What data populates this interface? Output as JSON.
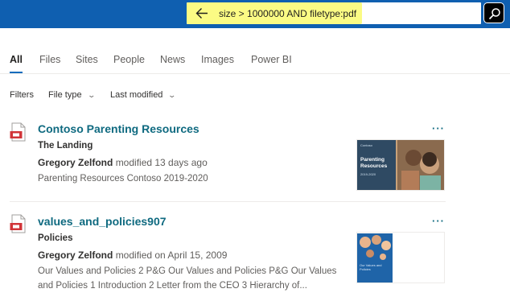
{
  "search": {
    "query": "size > 1000000 AND filetype:pdf"
  },
  "tabs": [
    {
      "label": "All"
    },
    {
      "label": "Files"
    },
    {
      "label": "Sites"
    },
    {
      "label": "People"
    },
    {
      "label": "News"
    },
    {
      "label": "Images"
    },
    {
      "label": "Power BI"
    }
  ],
  "filters": {
    "label": "Filters",
    "file_type": "File type",
    "last_modified": "Last modified"
  },
  "results": [
    {
      "title": "Contoso Parenting Resources",
      "site": "The Landing",
      "author": "Gregory Zelfond",
      "modified": "modified 13 days ago",
      "description": "Parenting Resources Contoso 2019-2020",
      "more": "···",
      "thumbnail_text": "Parenting Resources",
      "thumbnail_brand": "Contoso",
      "thumbnail_sub": "2019-2020"
    },
    {
      "title": "values_and_policies907",
      "site": "Policies",
      "author": "Gregory Zelfond",
      "modified": "modified on April 15, 2009",
      "description": "Our Values and Policies 2 P&G Our Values and Policies P&G Our Values and Policies 1 Introduction 2 Letter from the CEO 3 Hierarchy of...",
      "more": "···",
      "thumbnail_text": "Our Values and Policies"
    }
  ],
  "colors": {
    "top_bar": "#0f5fb0",
    "highlight": "#fbfb84",
    "link": "#0f6a80",
    "pdf_red": "#d13438"
  }
}
